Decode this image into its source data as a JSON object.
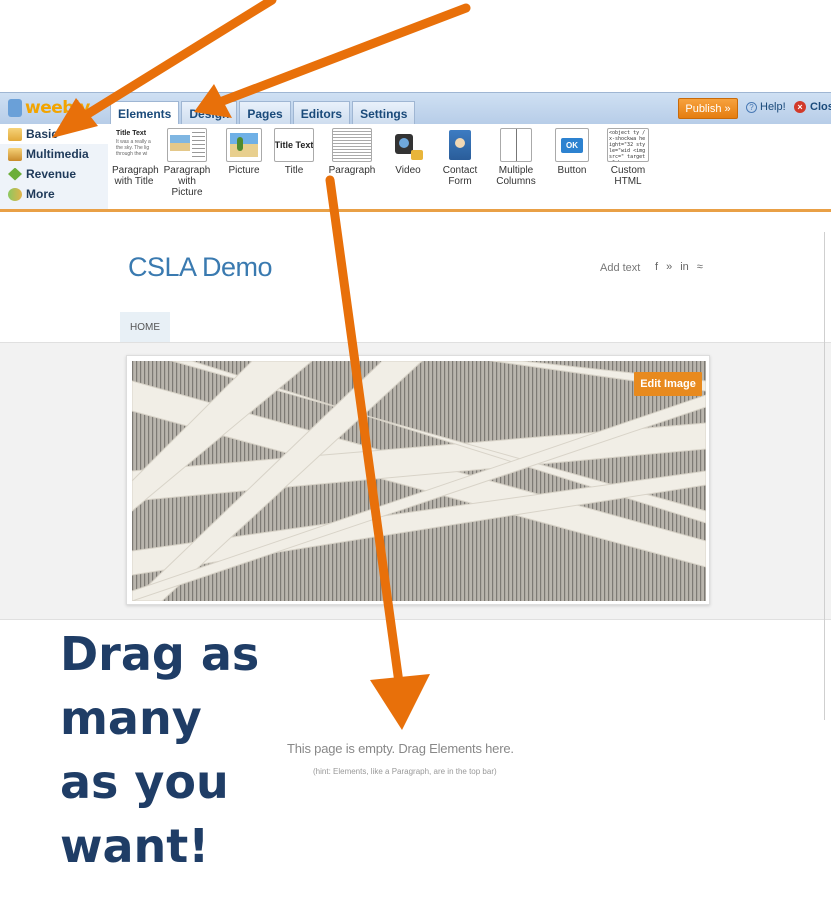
{
  "toolbar": {
    "logo": "weebly",
    "tabs": [
      "Elements",
      "Design",
      "Pages",
      "Editors",
      "Settings"
    ],
    "active_tab": "Elements",
    "publish": "Publish »",
    "help": "Help!",
    "close": "Close"
  },
  "categories": [
    "Basic",
    "Multimedia",
    "Revenue",
    "More"
  ],
  "active_category": "Basic",
  "elements": [
    {
      "label": "Paragraph\nwith Title",
      "thumb_title": "Title Text",
      "thumb_text": "It was a really a the sky. The lig through the wi"
    },
    {
      "label": "Paragraph\nwith Picture"
    },
    {
      "label": "Picture"
    },
    {
      "label": "Title",
      "thumb_title": "Title Text"
    },
    {
      "label": "Paragraph"
    },
    {
      "label": "Video"
    },
    {
      "label": "Contact\nForm"
    },
    {
      "label": "Multiple\nColumns"
    },
    {
      "label": "Button",
      "thumb_title": "OK"
    },
    {
      "label": "Custom\nHTML",
      "thumb_code": "<object ty /x-shockwa height=\"32 style=\"wid <img src=\" target=\"_b"
    }
  ],
  "site": {
    "title": "CSLA Demo",
    "add_text": "Add text",
    "social": [
      "f",
      "»",
      "in",
      "≈"
    ],
    "nav": [
      "HOME"
    ],
    "edit_image": "Edit Image",
    "empty_message": "This page is empty. Drag Elements here.",
    "hint": "(hint: Elements, like a Paragraph, are in the top bar)"
  },
  "annotation": {
    "lines": [
      "Drag as",
      "many",
      "as you",
      "want!"
    ],
    "color": "#1f3d66",
    "arrow_color": "#e8700a"
  }
}
